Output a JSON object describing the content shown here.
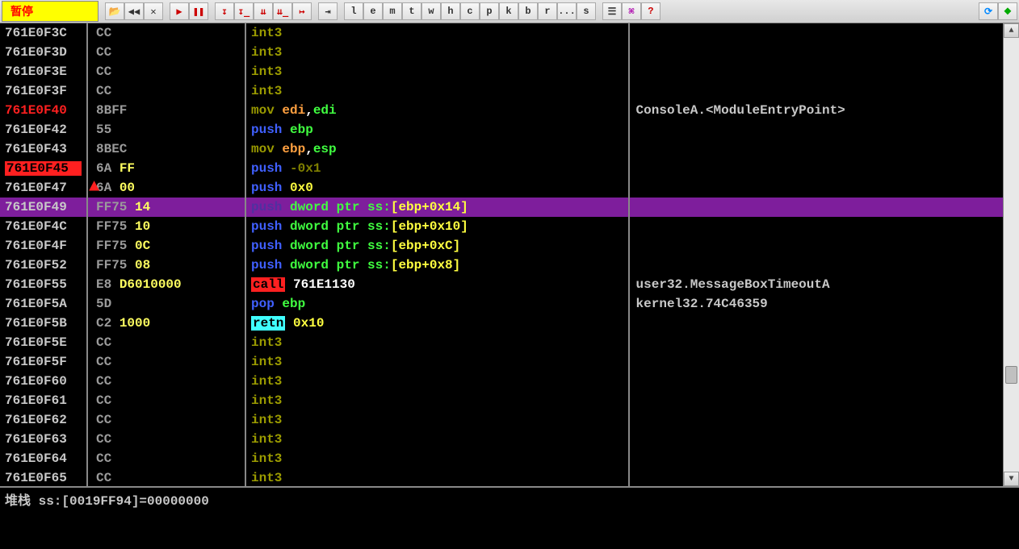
{
  "status_label": "暂停",
  "toolbar": {
    "letter_buttons": [
      "l",
      "e",
      "m",
      "t",
      "w",
      "h",
      "c",
      "p",
      "k",
      "b",
      "r",
      "...",
      "s"
    ]
  },
  "disasm_rows": [
    {
      "idx": 0,
      "addr": "761E0F3C",
      "bytes_op": "CC",
      "bytes_arg": "",
      "instr": "int3",
      "comment": ""
    },
    {
      "idx": 1,
      "addr": "761E0F3D",
      "bytes_op": "CC",
      "bytes_arg": "",
      "instr": "int3",
      "comment": ""
    },
    {
      "idx": 2,
      "addr": "761E0F3E",
      "bytes_op": "CC",
      "bytes_arg": "",
      "instr": "int3",
      "comment": ""
    },
    {
      "idx": 3,
      "addr": "761E0F3F",
      "bytes_op": "CC",
      "bytes_arg": "",
      "instr": "int3",
      "comment": ""
    },
    {
      "idx": 4,
      "addr": "761E0F40",
      "addr_style": "red",
      "bytes_op": "8BFF",
      "bytes_arg": "",
      "instr": "mov_edi_edi",
      "comment": "ConsoleA.<ModuleEntryPoint>"
    },
    {
      "idx": 5,
      "addr": "761E0F42",
      "bytes_op": "55",
      "bytes_arg": "",
      "instr": "push_ebp",
      "comment": ""
    },
    {
      "idx": 6,
      "addr": "761E0F43",
      "bytes_op": "8BEC",
      "bytes_arg": "",
      "instr": "mov_ebp_esp",
      "comment": ""
    },
    {
      "idx": 7,
      "addr": "761E0F45",
      "addr_style": "bp",
      "bytes_op": "6A",
      "bytes_arg": "FF",
      "instr": "push_-0x1",
      "comment": ""
    },
    {
      "idx": 8,
      "addr": "761E0F47",
      "bytes_op": "6A",
      "bytes_arg": "00",
      "instr": "push_0x0",
      "comment": ""
    },
    {
      "idx": 9,
      "addr": "761E0F49",
      "sel": true,
      "bytes_op": "FF75",
      "bytes_arg": "14",
      "instr": "push_dword_14",
      "comment": ""
    },
    {
      "idx": 10,
      "addr": "761E0F4C",
      "bytes_op": "FF75",
      "bytes_arg": "10",
      "instr": "push_dword_10",
      "comment": ""
    },
    {
      "idx": 11,
      "addr": "761E0F4F",
      "bytes_op": "FF75",
      "bytes_arg": "0C",
      "instr": "push_dword_0C",
      "comment": ""
    },
    {
      "idx": 12,
      "addr": "761E0F52",
      "bytes_op": "FF75",
      "bytes_arg": "08",
      "instr": "push_dword_08",
      "comment": ""
    },
    {
      "idx": 13,
      "addr": "761E0F55",
      "bytes_op": "E8",
      "bytes_arg": "D6010000",
      "instr": "call_761E1130",
      "comment": "user32.MessageBoxTimeoutA"
    },
    {
      "idx": 14,
      "addr": "761E0F5A",
      "bytes_op": "5D",
      "bytes_arg": "",
      "instr": "pop_ebp",
      "comment": "kernel32.74C46359"
    },
    {
      "idx": 15,
      "addr": "761E0F5B",
      "bytes_op": "C2",
      "bytes_arg": "1000",
      "instr": "retn_0x10",
      "comment": ""
    },
    {
      "idx": 16,
      "addr": "761E0F5E",
      "bytes_op": "CC",
      "bytes_arg": "",
      "instr": "int3",
      "comment": ""
    },
    {
      "idx": 17,
      "addr": "761E0F5F",
      "bytes_op": "CC",
      "bytes_arg": "",
      "instr": "int3",
      "comment": ""
    },
    {
      "idx": 18,
      "addr": "761E0F60",
      "bytes_op": "CC",
      "bytes_arg": "",
      "instr": "int3",
      "comment": ""
    },
    {
      "idx": 19,
      "addr": "761E0F61",
      "bytes_op": "CC",
      "bytes_arg": "",
      "instr": "int3",
      "comment": ""
    },
    {
      "idx": 20,
      "addr": "761E0F62",
      "bytes_op": "CC",
      "bytes_arg": "",
      "instr": "int3",
      "comment": ""
    },
    {
      "idx": 21,
      "addr": "761E0F63",
      "bytes_op": "CC",
      "bytes_arg": "",
      "instr": "int3",
      "comment": ""
    },
    {
      "idx": 22,
      "addr": "761E0F64",
      "bytes_op": "CC",
      "bytes_arg": "",
      "instr": "int3",
      "comment": ""
    },
    {
      "idx": 23,
      "addr": "761E0F65",
      "bytes_op": "CC",
      "bytes_arg": "",
      "instr": "int3",
      "comment": ""
    }
  ],
  "instr_fragments": {
    "int3": [
      {
        "cls": "mnem-int3",
        "text": "int3"
      }
    ],
    "mov_edi_edi": [
      {
        "cls": "mnem-mov",
        "text": "mov "
      },
      {
        "cls": "regdst",
        "text": "edi"
      },
      {
        "cls": "",
        "text": ","
      },
      {
        "cls": "reg",
        "text": "edi"
      }
    ],
    "push_ebp": [
      {
        "cls": "mnem-push",
        "text": "push "
      },
      {
        "cls": "reg",
        "text": "ebp"
      }
    ],
    "mov_ebp_esp": [
      {
        "cls": "mnem-mov",
        "text": "mov "
      },
      {
        "cls": "regdst",
        "text": "ebp"
      },
      {
        "cls": "",
        "text": ","
      },
      {
        "cls": "reg",
        "text": "esp"
      }
    ],
    "push_-0x1": [
      {
        "cls": "mnem-push",
        "text": "push "
      },
      {
        "cls": "imm",
        "text": "-0x1"
      }
    ],
    "push_0x0": [
      {
        "cls": "mnem-push",
        "text": "push "
      },
      {
        "cls": "imm-off",
        "text": "0x0"
      }
    ],
    "push_dword_14": [
      {
        "cls": "seldim",
        "text": "push"
      },
      {
        "cls": "",
        "text": " "
      },
      {
        "cls": "mem",
        "text": "dword ptr ss:"
      },
      {
        "cls": "imm-off",
        "text": "[ebp+0x14]"
      }
    ],
    "push_dword_10": [
      {
        "cls": "mnem-push",
        "text": "push"
      },
      {
        "cls": "",
        "text": " "
      },
      {
        "cls": "mem",
        "text": "dword ptr ss:"
      },
      {
        "cls": "imm-off",
        "text": "[ebp+0x10]"
      }
    ],
    "push_dword_0C": [
      {
        "cls": "mnem-push",
        "text": "push"
      },
      {
        "cls": "",
        "text": " "
      },
      {
        "cls": "mem",
        "text": "dword ptr ss:"
      },
      {
        "cls": "imm-off",
        "text": "[ebp+0xC]"
      }
    ],
    "push_dword_08": [
      {
        "cls": "mnem-push",
        "text": "push"
      },
      {
        "cls": "",
        "text": " "
      },
      {
        "cls": "mem",
        "text": "dword ptr ss:"
      },
      {
        "cls": "imm-off",
        "text": "[ebp+0x8]"
      }
    ],
    "call_761E1130": [
      {
        "cls": "mnem-call",
        "text": "call"
      },
      {
        "cls": "",
        "text": " "
      },
      {
        "cls": "addr-lit",
        "text": "761E1130"
      }
    ],
    "pop_ebp": [
      {
        "cls": "mnem-pop",
        "text": "pop "
      },
      {
        "cls": "reg",
        "text": "ebp"
      }
    ],
    "retn_0x10": [
      {
        "cls": "mnem-retn",
        "text": "retn"
      },
      {
        "cls": "",
        "text": " "
      },
      {
        "cls": "imm-off",
        "text": "0x10"
      }
    ]
  },
  "bottom_pane_text": "堆栈 ss:[0019FF94]=00000000"
}
